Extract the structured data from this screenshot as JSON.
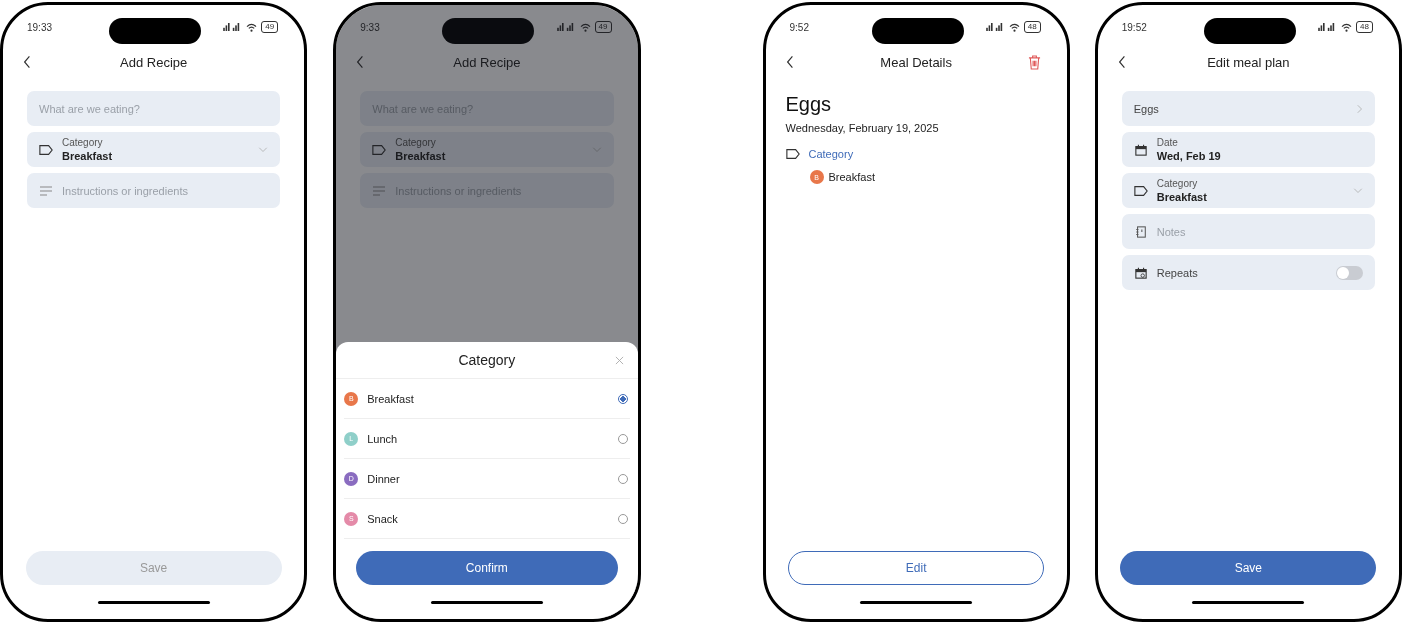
{
  "screens": [
    {
      "kind": "form",
      "time": "19:33",
      "battery": "49",
      "title": "Add Recipe",
      "dimmed": false,
      "fields": [
        {
          "kind": "text",
          "placeholder": "What are we eating?"
        },
        {
          "kind": "select",
          "label": "Category",
          "value": "Breakfast"
        },
        {
          "kind": "instructions",
          "placeholder": "Instructions or ingredients"
        }
      ],
      "button": {
        "kind": "primary",
        "label": "Save",
        "disabled": true
      }
    },
    {
      "kind": "form",
      "time": "9:33",
      "battery": "49",
      "title": "Add Recipe",
      "dimmed": true,
      "fields": [
        {
          "kind": "text",
          "placeholder": "What are we eating?"
        },
        {
          "kind": "select",
          "label": "Category",
          "value": "Breakfast"
        },
        {
          "kind": "instructions",
          "placeholder": "Instructions or ingredients"
        }
      ],
      "sheet": {
        "title": "Category",
        "options": [
          {
            "letter": "B",
            "label": "Breakfast",
            "color": "#e8774a",
            "selected": true
          },
          {
            "letter": "L",
            "label": "Lunch",
            "color": "#8fcfc9",
            "selected": false
          },
          {
            "letter": "D",
            "label": "Dinner",
            "color": "#8a6cc0",
            "selected": false
          },
          {
            "letter": "S",
            "label": "Snack",
            "color": "#e48aa8",
            "selected": false
          }
        ],
        "button": {
          "kind": "primary",
          "label": "Confirm",
          "disabled": false
        }
      }
    },
    {
      "kind": "details",
      "time": "9:52",
      "battery": "48",
      "title": "Meal Details",
      "heading": "Eggs",
      "date": "Wednesday, February 19, 2025",
      "section": "Category",
      "tag": {
        "letter": "B",
        "label": "Breakfast",
        "color": "#e8774a"
      },
      "button": {
        "kind": "outline",
        "label": "Edit",
        "disabled": false
      }
    },
    {
      "kind": "form",
      "time": "19:52",
      "battery": "48",
      "title": "Edit meal plan",
      "dimmed": false,
      "fields": [
        {
          "kind": "link",
          "value": "Eggs"
        },
        {
          "kind": "date",
          "label": "Date",
          "value": "Wed, Feb 19"
        },
        {
          "kind": "select",
          "label": "Category",
          "value": "Breakfast"
        },
        {
          "kind": "notes",
          "placeholder": "Notes"
        },
        {
          "kind": "toggle",
          "label": "Repeats",
          "on": false
        }
      ],
      "button": {
        "kind": "primary",
        "label": "Save",
        "disabled": false
      }
    }
  ]
}
